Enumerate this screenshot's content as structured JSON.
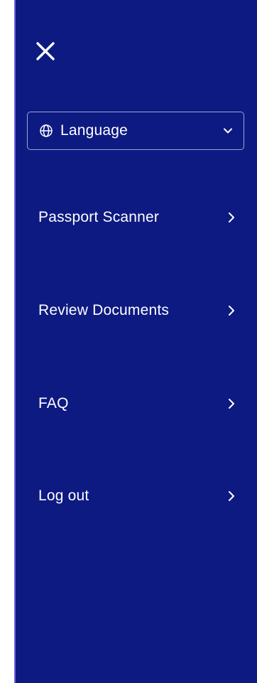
{
  "menu": {
    "close_icon": "close-icon",
    "language": {
      "label": "Language",
      "icon": "globe-icon",
      "dropdown_icon": "chevron-down-icon"
    },
    "items": [
      {
        "label": "Passport Scanner",
        "icon": "chevron-right-icon"
      },
      {
        "label": "Review Documents",
        "icon": "chevron-right-icon"
      },
      {
        "label": "FAQ",
        "icon": "chevron-right-icon"
      },
      {
        "label": "Log out",
        "icon": "chevron-right-icon"
      }
    ]
  },
  "colors": {
    "panel_background": "#0d1a82",
    "text": "#ffffff",
    "select_border": "#9ea3d6"
  }
}
